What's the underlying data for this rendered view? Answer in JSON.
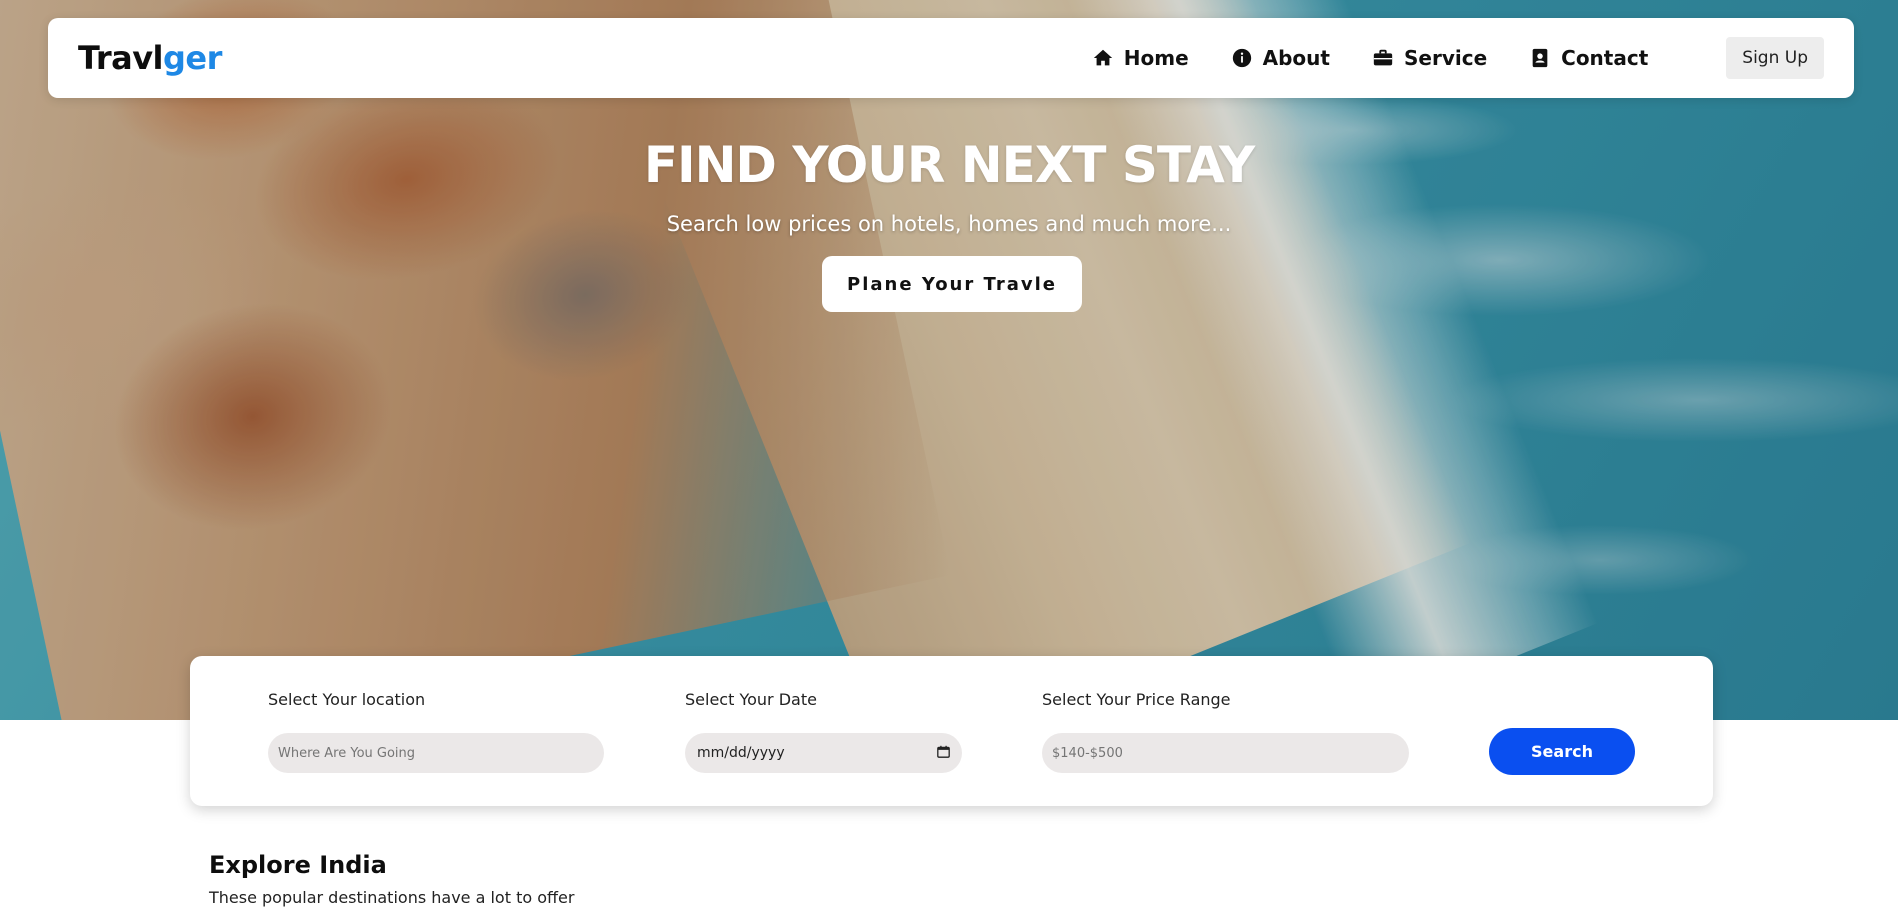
{
  "brand": {
    "logo_part1": "Travl",
    "logo_part2": "ger",
    "accent": "#1e88e5"
  },
  "nav": {
    "items": [
      {
        "label": "Home",
        "icon": "home-icon"
      },
      {
        "label": "About",
        "icon": "info-icon"
      },
      {
        "label": "Service",
        "icon": "briefcase-icon"
      },
      {
        "label": "Contact",
        "icon": "contact-book-icon"
      }
    ],
    "signup_label": "Sign Up"
  },
  "hero": {
    "title": "FIND YOUR NEXT STAY",
    "subtitle": "Search low prices on hotels, homes and much more...",
    "cta_label": "Plane Your Travle"
  },
  "search": {
    "location_label": "Select Your location",
    "location_placeholder": "Where Are You Going",
    "date_label": "Select Your Date",
    "date_value": "mm/dd/yyyy",
    "price_label": "Select Your Price Range",
    "price_placeholder": "$140-$500",
    "button_label": "Search",
    "button_color": "#0a4ff0"
  },
  "explore": {
    "title": "Explore India",
    "subtitle": "These popular destinations have a lot to offer"
  }
}
